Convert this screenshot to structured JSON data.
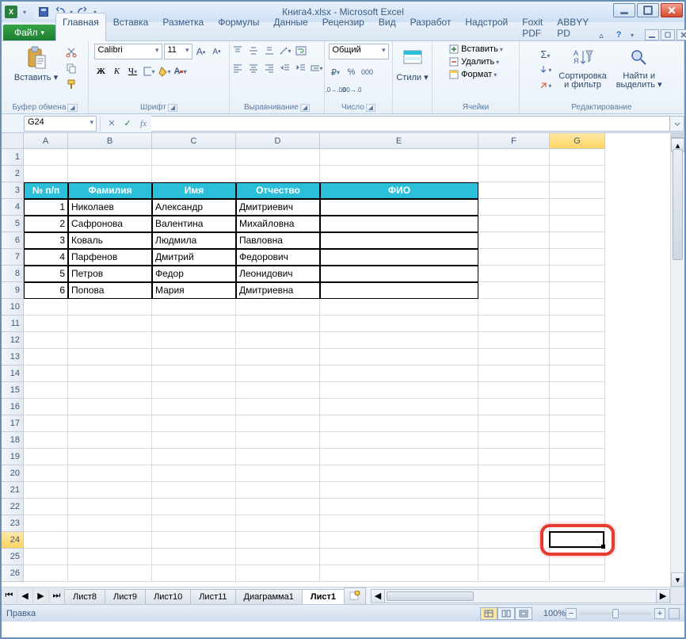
{
  "title": "Книга4.xlsx - Microsoft Excel",
  "file_tab": "Файл",
  "tabs": [
    "Главная",
    "Вставка",
    "Разметка",
    "Формулы",
    "Данные",
    "Рецензир",
    "Вид",
    "Разработ",
    "Надстрой",
    "Foxit PDF",
    "ABBYY PD"
  ],
  "active_tab_index": 0,
  "ribbon": {
    "clipboard": {
      "paste": "Вставить",
      "group": "Буфер обмена"
    },
    "font": {
      "name": "Calibri",
      "size": "11",
      "group": "Шрифт"
    },
    "alignment": {
      "group": "Выравнивание"
    },
    "number": {
      "format": "Общий",
      "group": "Число"
    },
    "styles": {
      "btn": "Стили",
      "group": ""
    },
    "cells": {
      "insert": "Вставить",
      "delete": "Удалить",
      "format": "Формат",
      "group": "Ячейки"
    },
    "editing": {
      "sort": "Сортировка\nи фильтр",
      "find": "Найти и\nвыделить",
      "group": "Редактирование"
    }
  },
  "name_box": "G24",
  "formula": "",
  "columns": [
    "A",
    "B",
    "C",
    "D",
    "E",
    "F",
    "G"
  ],
  "row_count": 26,
  "selected_col": "G",
  "selected_row": 24,
  "table": {
    "header_row": 3,
    "headers": [
      "№ п/п",
      "Фамилия",
      "Имя",
      "Отчество",
      "ФИО"
    ],
    "rows": [
      [
        "1",
        "Николаев",
        "Александр",
        "Дмитриевич",
        ""
      ],
      [
        "2",
        "Сафронова",
        "Валентина",
        "Михайловна",
        ""
      ],
      [
        "3",
        "Коваль",
        "Людмила",
        "Павловна",
        ""
      ],
      [
        "4",
        "Парфенов",
        "Дмитрий",
        "Федорович",
        ""
      ],
      [
        "5",
        "Петров",
        "Федор",
        "Леонидович",
        ""
      ],
      [
        "6",
        "Попова",
        "Мария",
        "Дмитриевна",
        ""
      ]
    ]
  },
  "sheets": [
    "Лист8",
    "Лист9",
    "Лист10",
    "Лист11",
    "Диаграмма1",
    "Лист1"
  ],
  "active_sheet_index": 5,
  "status": "Правка",
  "zoom": "100%"
}
